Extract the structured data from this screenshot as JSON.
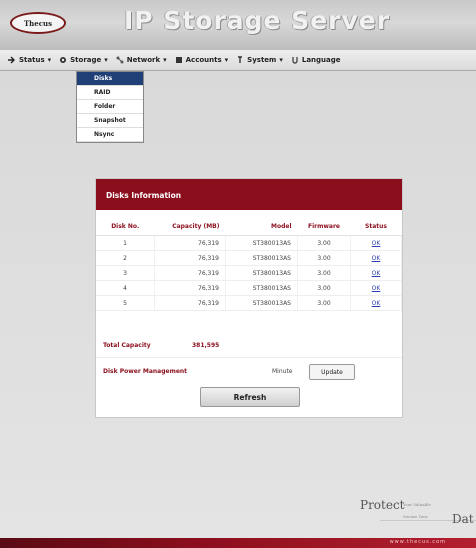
{
  "app": {
    "logo_text": "Thecus",
    "title": "IP Storage Server"
  },
  "nav": [
    {
      "label": "Status",
      "icon": "arrow-icon"
    },
    {
      "label": "Storage",
      "icon": "gear-icon"
    },
    {
      "label": "Network",
      "icon": "network-icon"
    },
    {
      "label": "Accounts",
      "icon": "accounts-icon"
    },
    {
      "label": "System",
      "icon": "system-icon"
    },
    {
      "label": "Language",
      "icon": "language-icon"
    }
  ],
  "storage_menu": {
    "items": [
      "Disks",
      "RAID",
      "Folder",
      "Snapshot",
      "Nsync"
    ],
    "active": "Disks"
  },
  "disks_panel": {
    "title": "Disks Information",
    "columns": [
      "Disk No.",
      "Capacity (MB)",
      "Model",
      "Firmware",
      "Status"
    ],
    "rows": [
      {
        "disk": "1",
        "capacity": "76,319",
        "model": "ST380013AS",
        "firmware": "3.00",
        "status": "OK"
      },
      {
        "disk": "2",
        "capacity": "76,319",
        "model": "ST380013AS",
        "firmware": "3.00",
        "status": "OK"
      },
      {
        "disk": "3",
        "capacity": "76,319",
        "model": "ST380013AS",
        "firmware": "3.00",
        "status": "OK"
      },
      {
        "disk": "4",
        "capacity": "76,319",
        "model": "ST380013AS",
        "firmware": "3.00",
        "status": "OK"
      },
      {
        "disk": "5",
        "capacity": "76,319",
        "model": "ST380013AS",
        "firmware": "3.00",
        "status": "OK"
      }
    ],
    "total_capacity_label": "Total Capacity",
    "total_capacity_value": "381,595",
    "power_label": "Disk Power Management",
    "power_value": "Minute",
    "update_label": "Update",
    "refresh_label": "Refresh"
  },
  "footer": {
    "tagline_big": "Protect",
    "tagline_small1": "Your Valuable",
    "tagline_small2": "Secure Your",
    "tagline_big2": "Dat",
    "url": "www.thecus.com"
  },
  "colors": {
    "accent": "#8a0e1c",
    "menu_active": "#1f3f76",
    "link": "#2c3fb0"
  }
}
